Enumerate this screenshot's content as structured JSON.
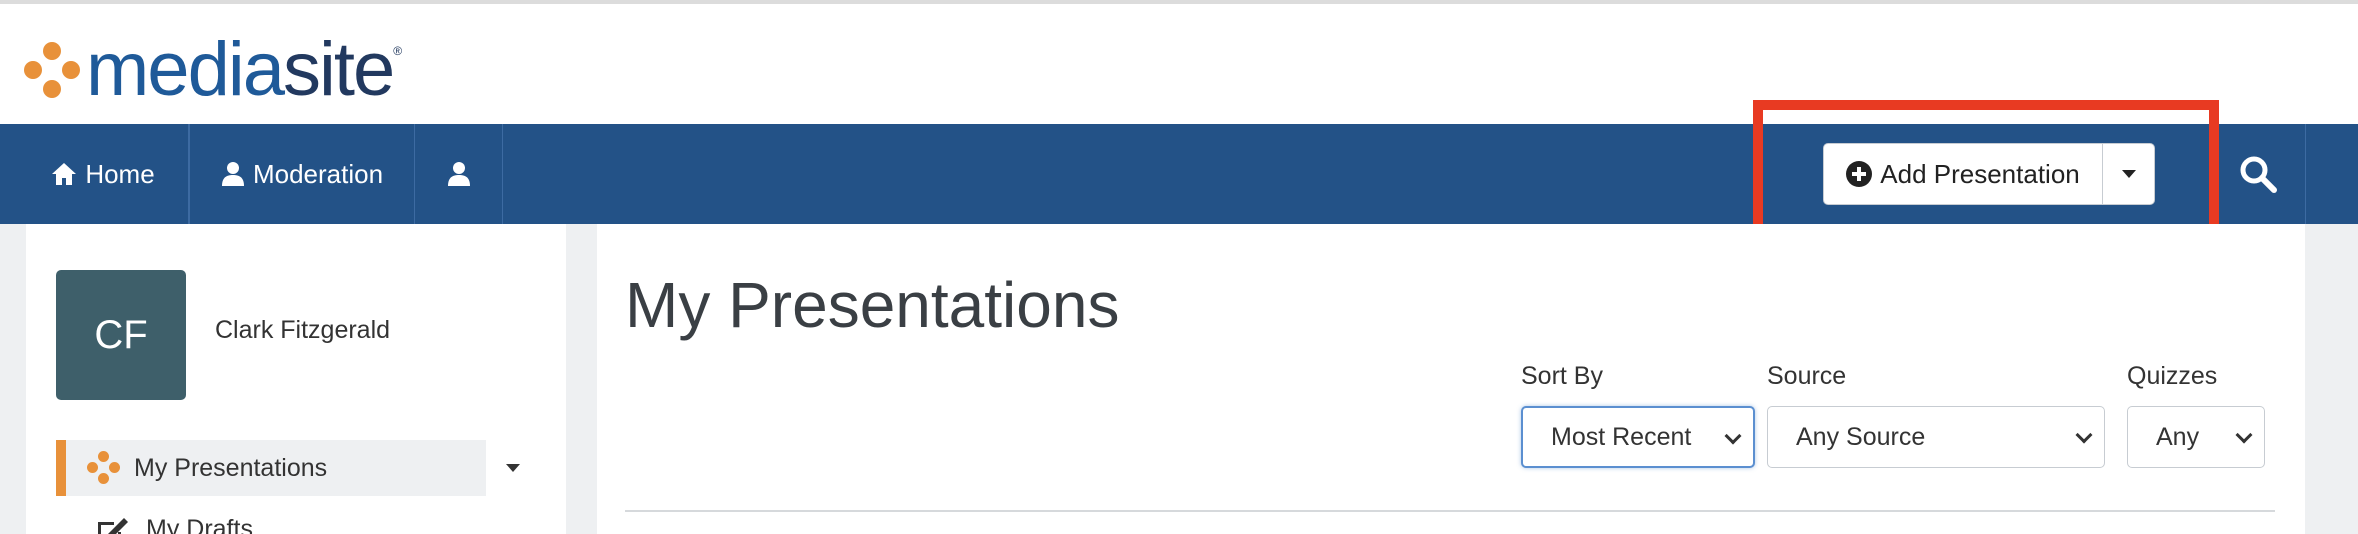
{
  "logo": {
    "text_part1": "media",
    "text_part2": "site",
    "registered": "®"
  },
  "nav": {
    "home_label": "Home",
    "moderation_label": "Moderation",
    "user_icon": "user-icon"
  },
  "actions": {
    "add_presentation_label": "Add Presentation",
    "search_icon": "search-icon"
  },
  "sidebar": {
    "avatar_initials": "CF",
    "user_name": "Clark Fitzgerald",
    "items": [
      {
        "label": "My Presentations",
        "active": true
      },
      {
        "label": "My Drafts",
        "active": false
      }
    ]
  },
  "main": {
    "title": "My Presentations",
    "filters": {
      "sort_by": {
        "label": "Sort By",
        "value": "Most Recent"
      },
      "source": {
        "label": "Source",
        "value": "Any Source"
      },
      "quizzes": {
        "label": "Quizzes",
        "value": "Any"
      }
    }
  },
  "colors": {
    "brand_blue": "#235287",
    "brand_orange": "#e8913a",
    "highlight_red": "#e83a22",
    "avatar_bg": "#3e5f6a"
  }
}
